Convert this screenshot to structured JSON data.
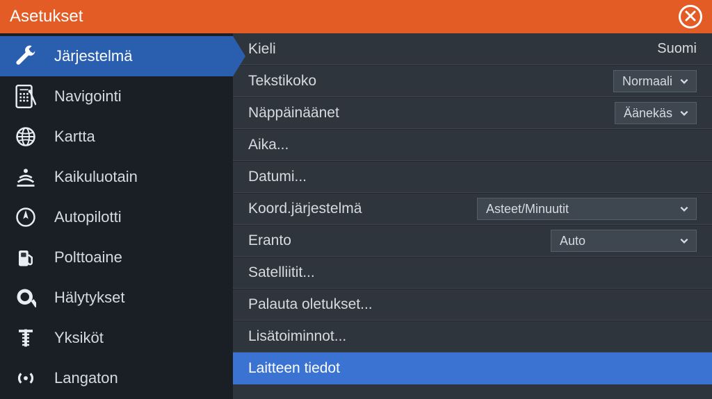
{
  "window": {
    "title": "Asetukset"
  },
  "sidebar": {
    "items": [
      {
        "label": "Järjestelmä"
      },
      {
        "label": "Navigointi"
      },
      {
        "label": "Kartta"
      },
      {
        "label": "Kaikuluotain"
      },
      {
        "label": "Autopilotti"
      },
      {
        "label": "Polttoaine"
      },
      {
        "label": "Hälytykset"
      },
      {
        "label": "Yksiköt"
      },
      {
        "label": "Langaton"
      }
    ]
  },
  "settings": {
    "language": {
      "label": "Kieli",
      "value": "Suomi"
    },
    "text_size": {
      "label": "Tekstikoko",
      "value": "Normaali"
    },
    "key_sounds": {
      "label": "Näppäinäänet",
      "value": "Äänekäs"
    },
    "time": {
      "label": "Aika..."
    },
    "datum": {
      "label": "Datumi..."
    },
    "coord_system": {
      "label": "Koord.järjestelmä",
      "value": "Asteet/Minuutit"
    },
    "variation": {
      "label": "Eranto",
      "value": "Auto"
    },
    "satellites": {
      "label": "Satelliitit..."
    },
    "restore": {
      "label": "Palauta oletukset..."
    },
    "advanced": {
      "label": "Lisätoiminnot..."
    },
    "about": {
      "label": "Laitteen tiedot"
    }
  }
}
